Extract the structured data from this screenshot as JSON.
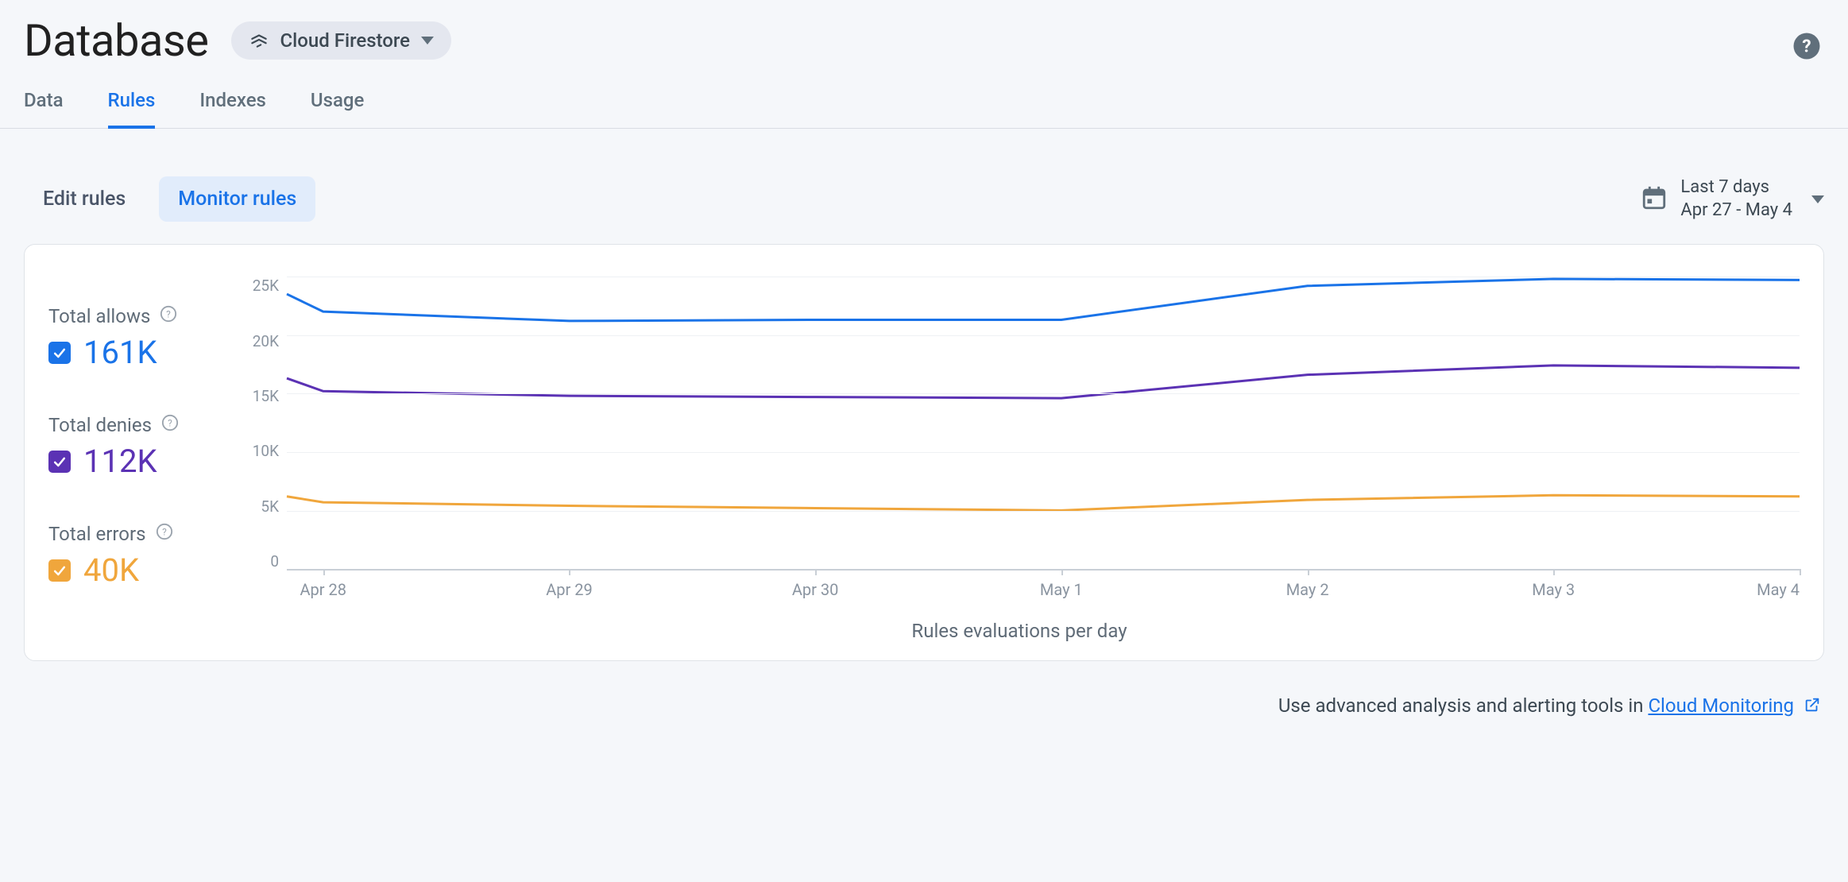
{
  "header": {
    "title": "Database",
    "selector_label": "Cloud Firestore"
  },
  "tabs": [
    {
      "label": "Data",
      "active": false
    },
    {
      "label": "Rules",
      "active": true
    },
    {
      "label": "Indexes",
      "active": false
    },
    {
      "label": "Usage",
      "active": false
    }
  ],
  "sub_tabs": [
    {
      "label": "Edit rules",
      "active": false
    },
    {
      "label": "Monitor rules",
      "active": true
    }
  ],
  "date_range": {
    "label": "Last 7 days",
    "range": "Apr 27 - May 4"
  },
  "legend": {
    "allows": {
      "label": "Total allows",
      "value": "161K",
      "color": "#1a73e8"
    },
    "denies": {
      "label": "Total denies",
      "value": "112K",
      "color": "#5b32b4"
    },
    "errors": {
      "label": "Total errors",
      "value": "40K",
      "color": "#f0a63c"
    }
  },
  "chart_data": {
    "type": "line",
    "title": "",
    "xlabel": "Rules evaluations per day",
    "ylabel": "",
    "ylim": [
      0,
      25000
    ],
    "y_ticks": [
      "25K",
      "20K",
      "15K",
      "10K",
      "5K",
      "0"
    ],
    "categories": [
      "Apr 28",
      "Apr 29",
      "Apr 30",
      "May 1",
      "May 2",
      "May 3",
      "May 4"
    ],
    "series": [
      {
        "name": "allows",
        "color": "#1a73e8",
        "values": [
          23500,
          22000,
          21200,
          21300,
          21300,
          24200,
          24800,
          24700
        ]
      },
      {
        "name": "denies",
        "color": "#5b32b4",
        "values": [
          16300,
          15200,
          14800,
          14700,
          14600,
          16600,
          17400,
          17200
        ]
      },
      {
        "name": "errors",
        "color": "#f0a63c",
        "values": [
          6200,
          5700,
          5400,
          5200,
          5000,
          5900,
          6300,
          6200
        ]
      }
    ],
    "x_positions_pct": [
      0,
      2.4,
      18.67,
      34.93,
      51.2,
      67.47,
      83.73,
      100
    ],
    "x_tick_positions_pct": [
      2.4,
      18.67,
      34.93,
      51.2,
      67.47,
      83.73,
      100
    ]
  },
  "footer": {
    "prefix": "Use advanced analysis and alerting tools in ",
    "link_label": "Cloud Monitoring"
  }
}
